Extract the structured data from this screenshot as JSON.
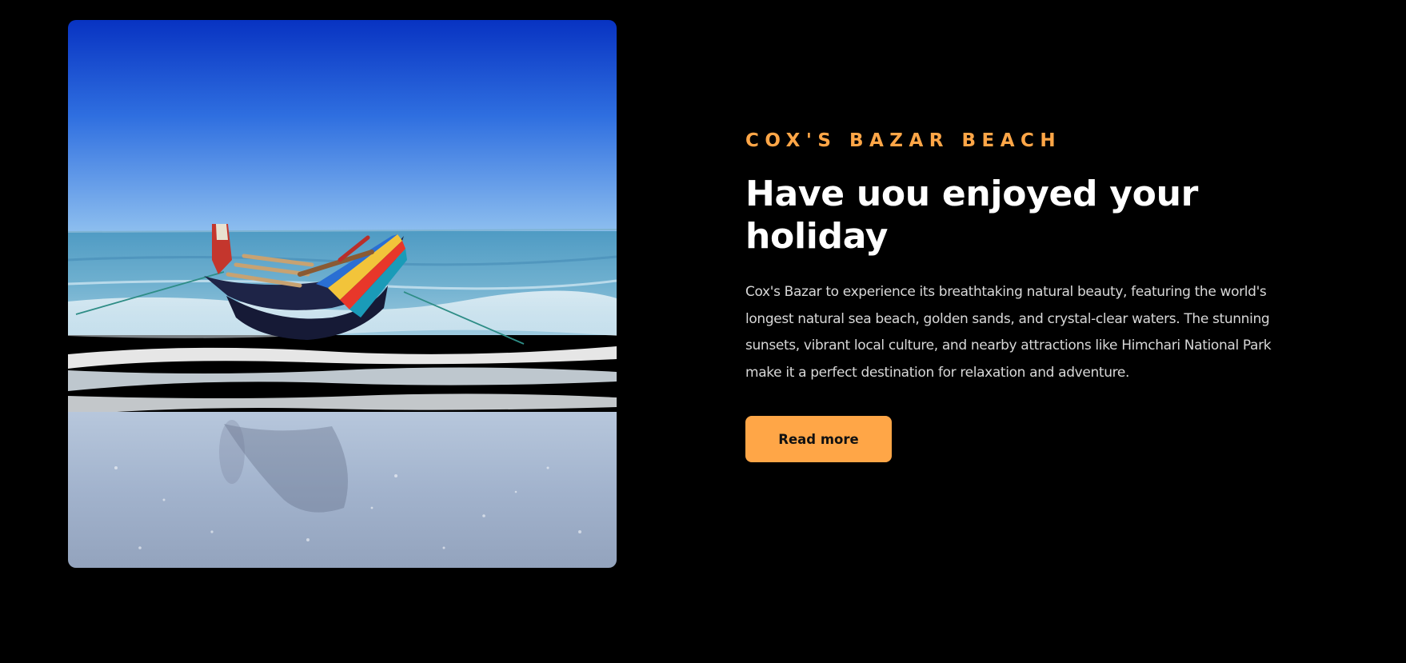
{
  "theme": {
    "background": "#000000",
    "accent": "#ffa647",
    "heading_color": "#ffffff",
    "body_text_color": "#d8d8d8"
  },
  "hero": {
    "image": {
      "subject": "colorful wooden fishing boat on a sandy beach with waves and blue sky",
      "icon": "beach-photo"
    },
    "eyebrow": "COX'S BAZAR BEACH",
    "headline": "Have uou enjoyed your holiday",
    "description": "Cox's Bazar to experience its breathtaking natural beauty, featuring the world's longest natural sea beach, golden sands, and crystal-clear waters. The stunning sunsets, vibrant local culture, and nearby attractions like Himchari National Park make it a perfect destination for relaxation and adventure.",
    "cta_label": "Read more"
  }
}
